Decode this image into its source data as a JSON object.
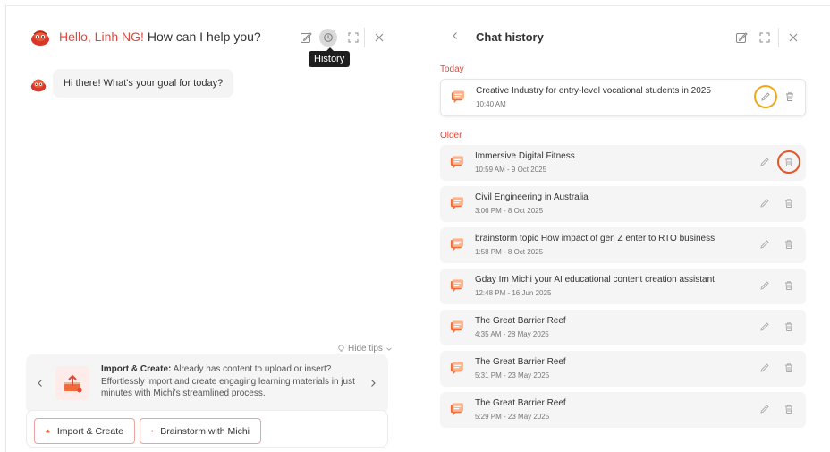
{
  "assistant": {
    "greeting_name": "Hello, Linh NG!",
    "greeting_rest": " How can I help you?",
    "tooltip": "History",
    "message": "Hi there! What's your goal for today?",
    "hide_tips": "Hide tips",
    "tip": {
      "title": "Import & Create:",
      "body": " Already has content to upload or insert? Effortlessly import and create engaging learning materials in just minutes with Michi's streamlined process."
    },
    "actions": [
      {
        "label": "Import & Create",
        "icon": "upload-icon"
      },
      {
        "label": "Brainstorm with Michi",
        "icon": "michi-icon"
      }
    ]
  },
  "history": {
    "title": "Chat history",
    "sections": [
      {
        "label": "Today"
      },
      {
        "label": "Older"
      }
    ],
    "today": [
      {
        "title": "Creative Industry for entry-level vocational students in 2025",
        "time": "10:40 AM"
      }
    ],
    "older": [
      {
        "title": "Immersive Digital Fitness",
        "time": "10:59 AM - 9 Oct 2025"
      },
      {
        "title": "Civil Engineering in Australia",
        "time": "3:06 PM - 8 Oct 2025"
      },
      {
        "title": "brainstorm topic How impact of gen Z enter to RTO business",
        "time": "1:58 PM - 8 Oct 2025"
      },
      {
        "title": "Gday Im Michi your AI educational content creation assistant",
        "time": "12:48 PM - 16 Jun 2025"
      },
      {
        "title": "The Great Barrier Reef",
        "time": "4:35 AM - 28 May 2025"
      },
      {
        "title": "The Great Barrier Reef",
        "time": "5:31 PM - 23 May 2025"
      },
      {
        "title": "The Great Barrier Reef",
        "time": "5:29 PM - 23 May 2025"
      }
    ]
  },
  "colors": {
    "accent": "#e4473c",
    "highlight_edit_ring": "#f0a818",
    "highlight_delete_ring": "#e2582a"
  }
}
